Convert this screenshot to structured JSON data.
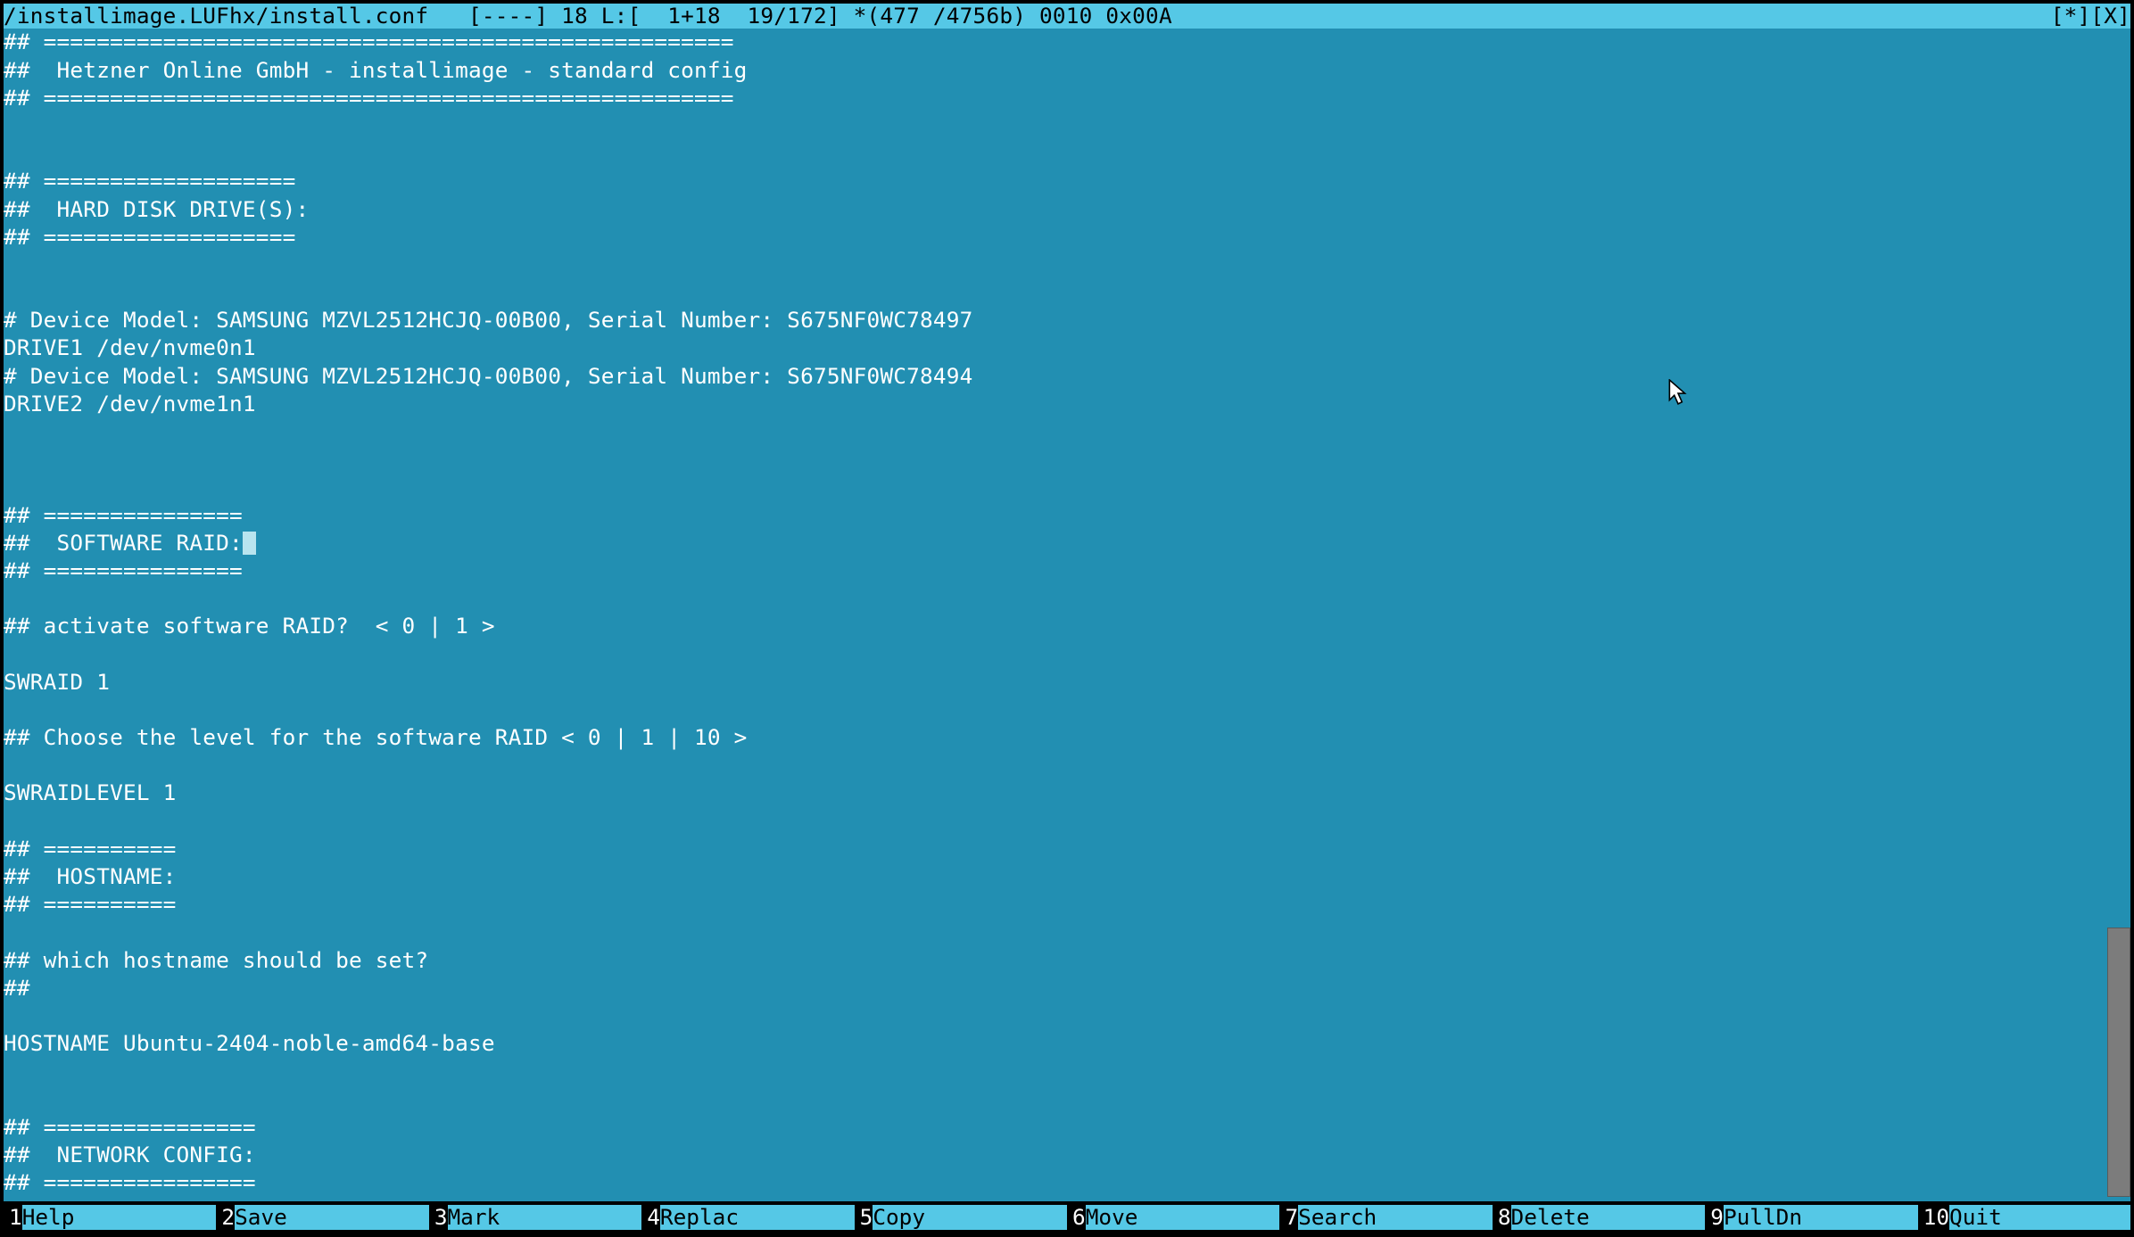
{
  "title": {
    "left": "/installimage.LUFhx/install.conf   [----] 18 L:[  1+18  19/172] *(477 /4756b) 0010 0x00A",
    "right": "[*][X]"
  },
  "lines": [
    "## ====================================================",
    "##  Hetzner Online GmbH - installimage - standard config",
    "## ====================================================",
    "",
    "",
    "## ===================",
    "##  HARD DISK DRIVE(S):",
    "## ===================",
    "",
    "",
    "# Device Model: SAMSUNG MZVL2512HCJQ-00B00, Serial Number: S675NF0WC78497",
    "DRIVE1 /dev/nvme0n1",
    "# Device Model: SAMSUNG MZVL2512HCJQ-00B00, Serial Number: S675NF0WC78494",
    "DRIVE2 /dev/nvme1n1",
    "",
    "",
    "",
    "## ===============",
    "##  SOFTWARE RAID:",
    "## ===============",
    "",
    "## activate software RAID?  < 0 | 1 >",
    "",
    "SWRAID 1",
    "",
    "## Choose the level for the software RAID < 0 | 1 | 10 >",
    "",
    "SWRAIDLEVEL 1",
    "",
    "## ==========",
    "##  HOSTNAME:",
    "## ==========",
    "",
    "## which hostname should be set?",
    "##",
    "",
    "HOSTNAME Ubuntu-2404-noble-amd64-base",
    "",
    "",
    "## ================",
    "##  NETWORK CONFIG:",
    "## ================"
  ],
  "cursor_line_index": 18,
  "footer": [
    {
      "num": "1",
      "lbl": "Help"
    },
    {
      "num": "2",
      "lbl": "Save"
    },
    {
      "num": "3",
      "lbl": "Mark"
    },
    {
      "num": "4",
      "lbl": "Replac"
    },
    {
      "num": "5",
      "lbl": "Copy"
    },
    {
      "num": "6",
      "lbl": "Move"
    },
    {
      "num": "7",
      "lbl": "Search"
    },
    {
      "num": "8",
      "lbl": "Delete"
    },
    {
      "num": "9",
      "lbl": "PullDn"
    },
    {
      "num": "10",
      "lbl": "Quit"
    }
  ],
  "colors": {
    "editor_bg": "#228fb2",
    "bar_bg": "#55c8e6",
    "text_fg": "#ffffff",
    "contrast_fg": "#000000"
  }
}
